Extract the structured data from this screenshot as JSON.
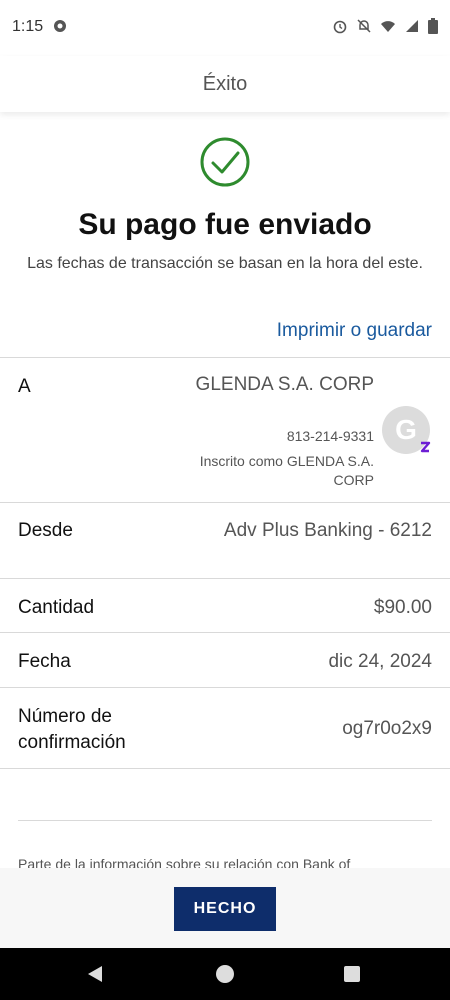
{
  "status_bar": {
    "time": "1:15"
  },
  "header": {
    "title": "Éxito"
  },
  "success": {
    "headline": "Su pago fue enviado",
    "subtext": "Las fechas de transacción se basan en la hora del este.",
    "print_link": "Imprimir o guardar"
  },
  "details": {
    "to": {
      "label": "A",
      "name": "GLENDA S.A. CORP",
      "phone": "813-214-9331",
      "enrolled": "Inscrito como GLENDA S.A. CORP",
      "avatar_initial": "G"
    },
    "from": {
      "label": "Desde",
      "value": "Adv Plus Banking - 6212"
    },
    "amount": {
      "label": "Cantidad",
      "value": "$90.00"
    },
    "date": {
      "label": "Fecha",
      "value": "dic 24, 2024"
    },
    "confirmation": {
      "label": "Número de confirmación",
      "value": "og7r0o2x9"
    }
  },
  "footer_note": "Parte de la información sobre su relación con Bank of",
  "actions": {
    "done_label": "HECHO"
  },
  "colors": {
    "accent": "#0e2d6b",
    "link": "#1a5a9e",
    "success": "#2e8b2e",
    "zelle": "#6d1ed4"
  }
}
